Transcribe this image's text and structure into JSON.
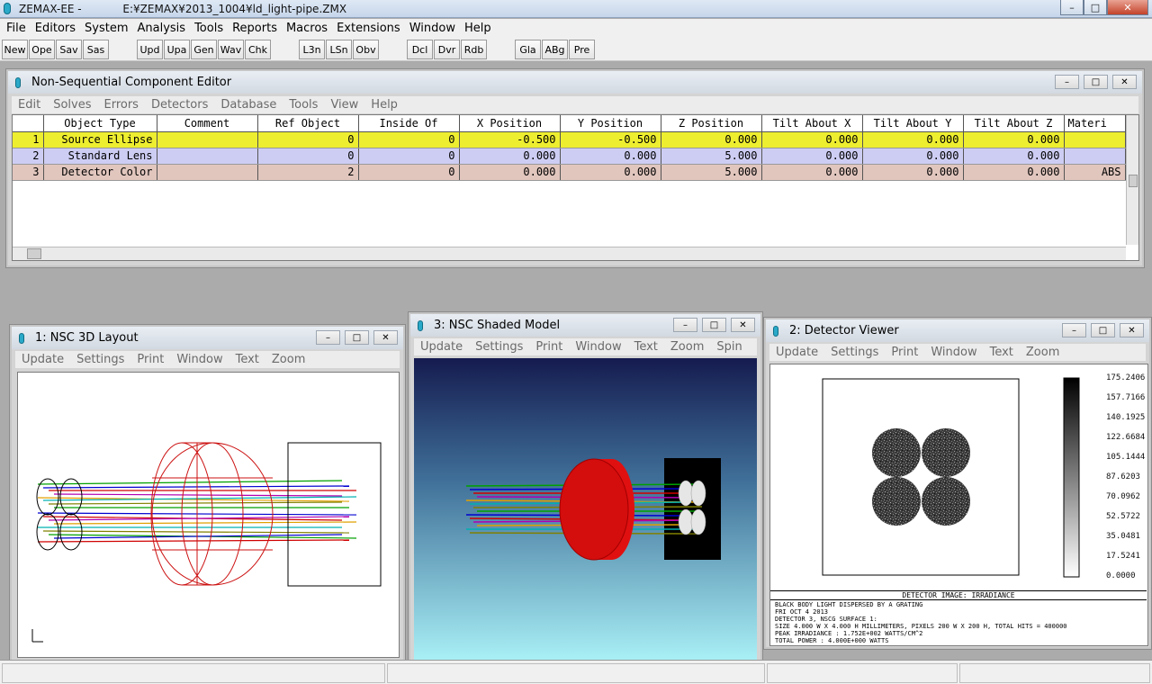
{
  "app": {
    "title_prefix": "ZEMAX-EE -",
    "title_path": "E:¥ZEMAX¥2013_1004¥ld_light-pipe.ZMX",
    "minimize": "–",
    "maximize": "□",
    "close": "✕"
  },
  "menu": [
    "File",
    "Editors",
    "System",
    "Analysis",
    "Tools",
    "Reports",
    "Macros",
    "Extensions",
    "Window",
    "Help"
  ],
  "toolbar": [
    "New",
    "Ope",
    "Sav",
    "Sas",
    "Upd",
    "Upa",
    "Gen",
    "Wav",
    "Chk",
    "L3n",
    "LSn",
    "Obv",
    "Dcl",
    "Dvr",
    "Rdb",
    "Gla",
    "ABg",
    "Pre"
  ],
  "editor": {
    "title": "Non-Sequential Component Editor",
    "menu": [
      "Edit",
      "Solves",
      "Errors",
      "Detectors",
      "Database",
      "Tools",
      "View",
      "Help"
    ],
    "columns": [
      "Object Type",
      "Comment",
      "Ref Object",
      "Inside Of",
      "X Position",
      "Y Position",
      "Z Position",
      "Tilt About X",
      "Tilt About Y",
      "Tilt About Z",
      "Materi"
    ],
    "rows": [
      {
        "num": "1",
        "type": "Source Ellipse",
        "comment": "",
        "ref": "0",
        "inside": "0",
        "x": "-0.500",
        "y": "-0.500",
        "z": "0.000",
        "tx": "0.000",
        "ty": "0.000",
        "tz": "0.000",
        "mat": ""
      },
      {
        "num": "2",
        "type": "Standard Lens",
        "comment": "",
        "ref": "0",
        "inside": "0",
        "x": "0.000",
        "y": "0.000",
        "z": "5.000",
        "tx": "0.000",
        "ty": "0.000",
        "tz": "0.000",
        "mat": ""
      },
      {
        "num": "3",
        "type": "Detector Color",
        "comment": "",
        "ref": "2",
        "inside": "0",
        "x": "0.000",
        "y": "0.000",
        "z": "5.000",
        "tx": "0.000",
        "ty": "0.000",
        "tz": "0.000",
        "mat": "ABS"
      }
    ]
  },
  "layout3d": {
    "title": "1: NSC 3D Layout",
    "menu": [
      "Update",
      "Settings",
      "Print",
      "Window",
      "Text",
      "Zoom"
    ]
  },
  "shaded": {
    "title": "3: NSC Shaded Model",
    "menu": [
      "Update",
      "Settings",
      "Print",
      "Window",
      "Text",
      "Zoom",
      "Spin"
    ]
  },
  "detector": {
    "title": "2: Detector Viewer",
    "menu": [
      "Update",
      "Settings",
      "Print",
      "Window",
      "Text",
      "Zoom"
    ],
    "legend": [
      "175.2406",
      "157.7166",
      "140.1925",
      "122.6684",
      "105.1444",
      "87.6203",
      "70.0962",
      "52.5722",
      "35.0481",
      "17.5241",
      "0.0000"
    ],
    "image_title": "DETECTOR IMAGE: IRRADIANCE",
    "info": [
      "BLACK BODY LIGHT DISPERSED BY A GRATING",
      "FRI OCT 4 2013",
      "DETECTOR 3, NSCG SURFACE 1:",
      "SIZE 4.000 W X 4.000 H MILLIMETERS, PIXELS 200 W X 200 H, TOTAL HITS = 400000",
      "PEAK IRRADIANCE : 1.752E+002 WATTS/CM^2",
      "TOTAL POWER     : 4.000E+000 WATTS"
    ]
  },
  "colors": {
    "row_source": "#eeee30",
    "row_lens": "#cdcdf4",
    "row_detector": "#e1c6be",
    "lens_red": "#cc1111",
    "ray_colors": [
      "#00a000",
      "#0000d0",
      "#d00000",
      "#b000b0",
      "#e0a000",
      "#00b0b0",
      "#808000"
    ]
  }
}
